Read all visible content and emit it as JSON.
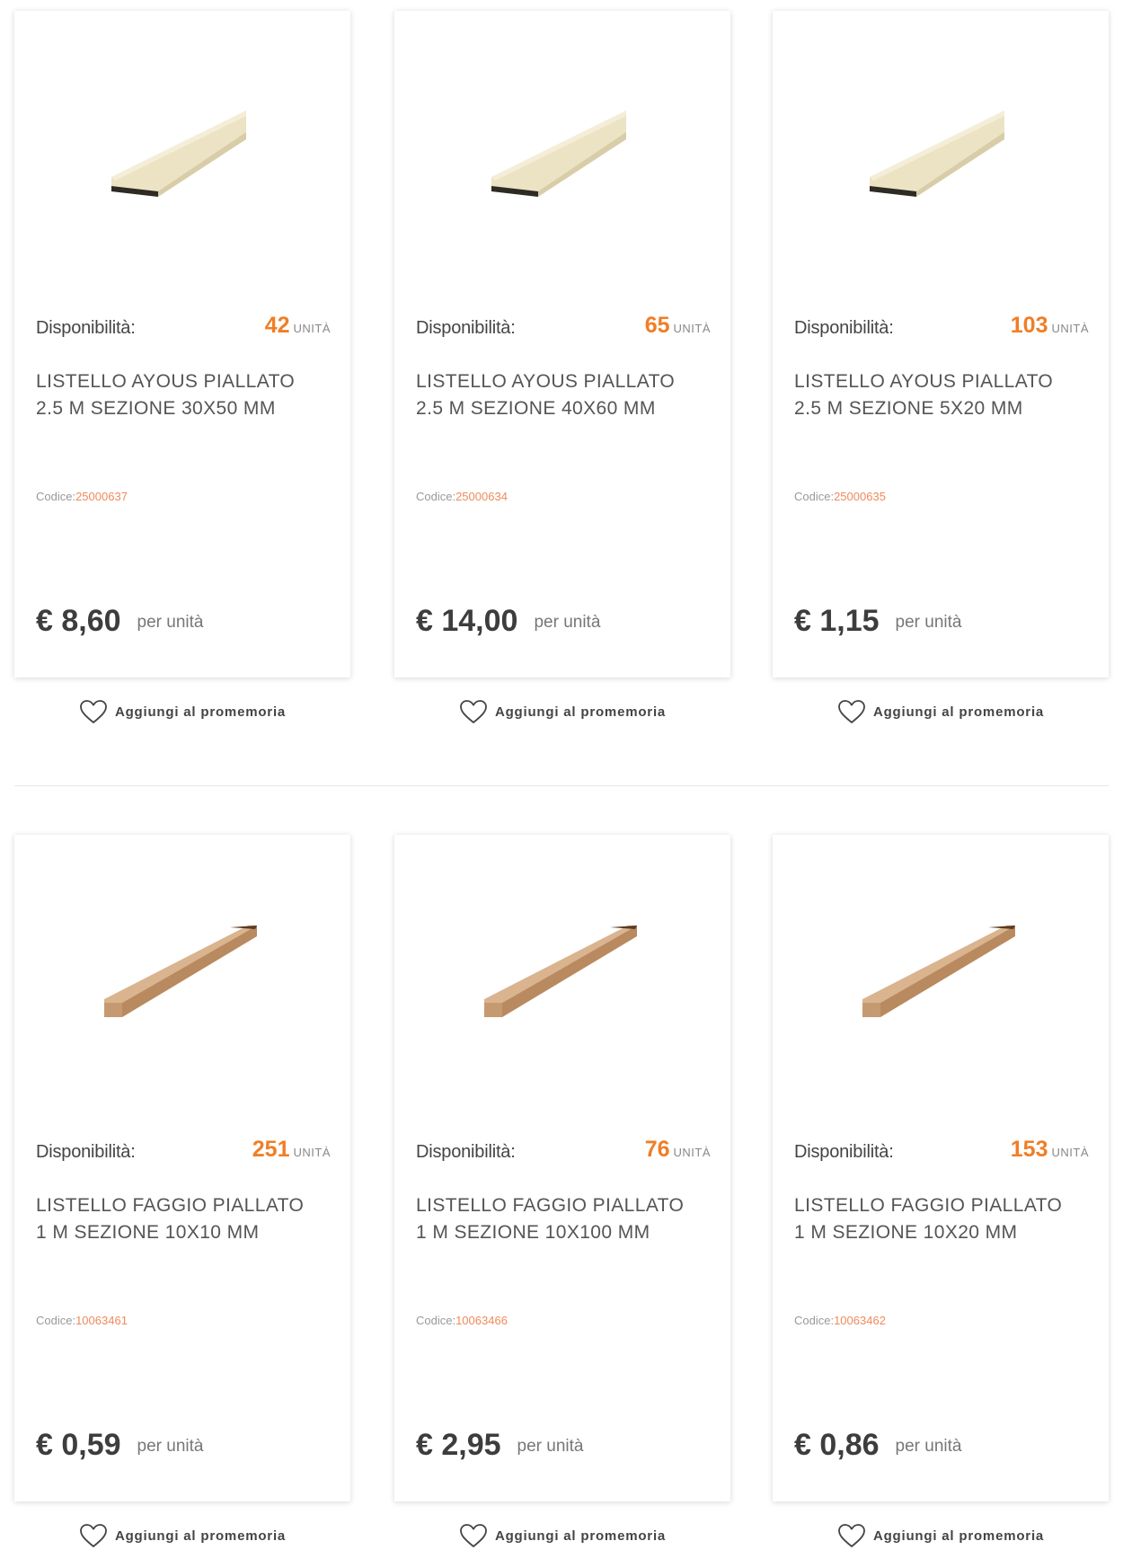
{
  "labels": {
    "availability": "Disponibilità:",
    "unit": "UNITÀ",
    "code_prefix": "Codice:",
    "per_unit": "per unità",
    "wishlist": "Aggiungi al promemoria"
  },
  "products": [
    {
      "stock": "42",
      "title_line1": "LISTELLO AYOUS PIALLATO",
      "title_line2": "2.5 M SEZIONE 30X50 MM",
      "code": "25000637",
      "price": "€ 8,60",
      "image": "wide-plank"
    },
    {
      "stock": "65",
      "title_line1": "LISTELLO AYOUS PIALLATO",
      "title_line2": "2.5 M SEZIONE 40X60 MM",
      "code": "25000634",
      "price": "€ 14,00",
      "image": "wide-plank"
    },
    {
      "stock": "103",
      "title_line1": "LISTELLO AYOUS PIALLATO",
      "title_line2": "2.5 M SEZIONE 5X20 MM",
      "code": "25000635",
      "price": "€ 1,15",
      "image": "wide-plank"
    },
    {
      "stock": "251",
      "title_line1": "LISTELLO FAGGIO PIALLATO",
      "title_line2": "1 M SEZIONE 10X10 MM",
      "code": "10063461",
      "price": "€ 0,59",
      "image": "thin-batten"
    },
    {
      "stock": "76",
      "title_line1": "LISTELLO FAGGIO PIALLATO",
      "title_line2": "1 M SEZIONE 10X100 MM",
      "code": "10063466",
      "price": "€ 2,95",
      "image": "thin-batten"
    },
    {
      "stock": "153",
      "title_line1": "LISTELLO FAGGIO PIALLATO",
      "title_line2": "1 M SEZIONE 10X20 MM",
      "code": "10063462",
      "price": "€ 0,86",
      "image": "thin-batten"
    }
  ],
  "colors": {
    "accent": "#f07e26",
    "code": "#f08a5d",
    "text": "#444444",
    "ayous_wood": "#ece3c4",
    "beech_wood": "#d9b48f"
  }
}
